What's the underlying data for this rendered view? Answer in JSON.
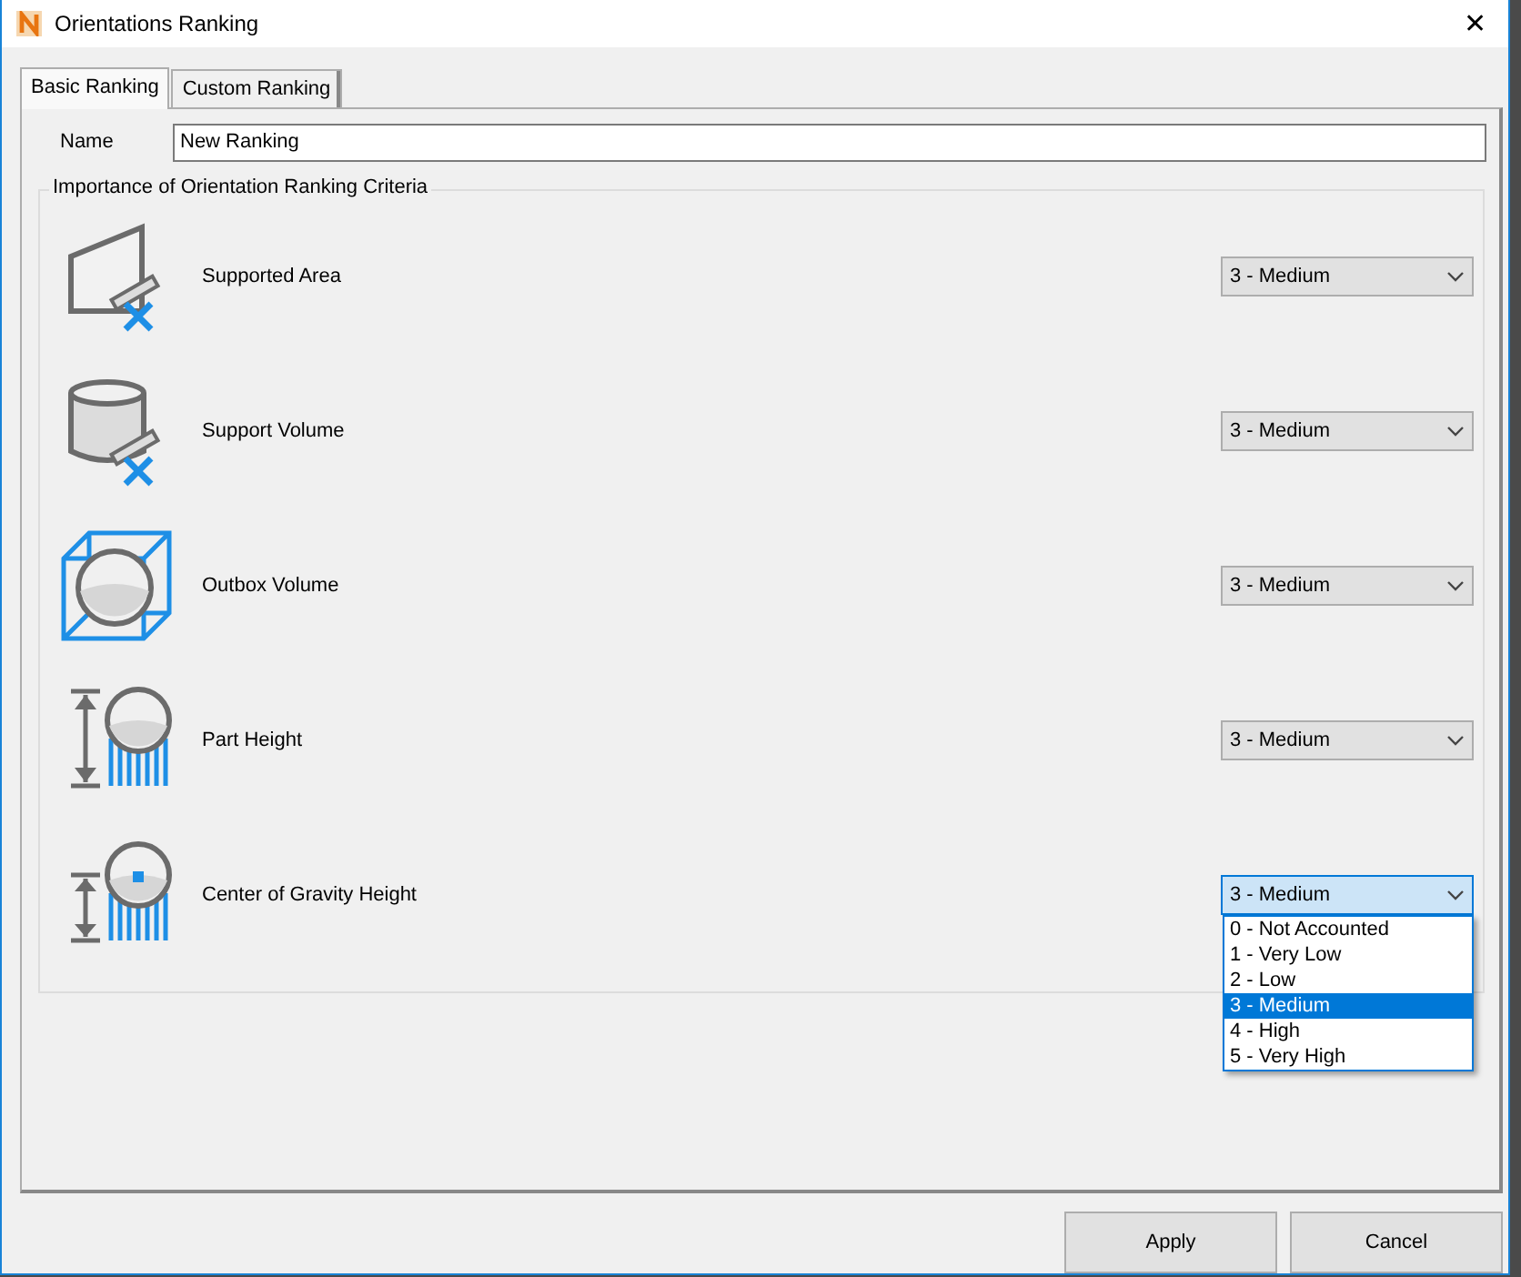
{
  "window": {
    "title": "Orientations Ranking",
    "close": "✕"
  },
  "tabs": [
    {
      "label": "Basic Ranking",
      "selected": true
    },
    {
      "label": "Custom Ranking",
      "selected": false
    }
  ],
  "name_field": {
    "label": "Name",
    "value": "New Ranking"
  },
  "group": {
    "title": "Importance of Orientation Ranking Criteria",
    "criteria": [
      {
        "kind": "area",
        "label": "Supported Area",
        "value": "3 - Medium",
        "open": false
      },
      {
        "kind": "volume",
        "label": "Support Volume",
        "value": "3 - Medium",
        "open": false
      },
      {
        "kind": "outbox",
        "label": "Outbox Volume",
        "value": "3 - Medium",
        "open": false
      },
      {
        "kind": "height",
        "label": "Part Height",
        "value": "3 - Medium",
        "open": false
      },
      {
        "kind": "gravity",
        "label": "Center of Gravity Height",
        "value": "3 - Medium",
        "open": true,
        "options": [
          {
            "label": "0 - Not Accounted",
            "selected": false
          },
          {
            "label": "1 - Very Low",
            "selected": false
          },
          {
            "label": "2 - Low",
            "selected": false
          },
          {
            "label": "3 - Medium",
            "selected": true
          },
          {
            "label": "4 - High",
            "selected": false
          },
          {
            "label": "5 - Very High",
            "selected": false
          }
        ]
      }
    ]
  },
  "buttons": [
    {
      "label": "Apply"
    },
    {
      "label": "Cancel"
    }
  ]
}
